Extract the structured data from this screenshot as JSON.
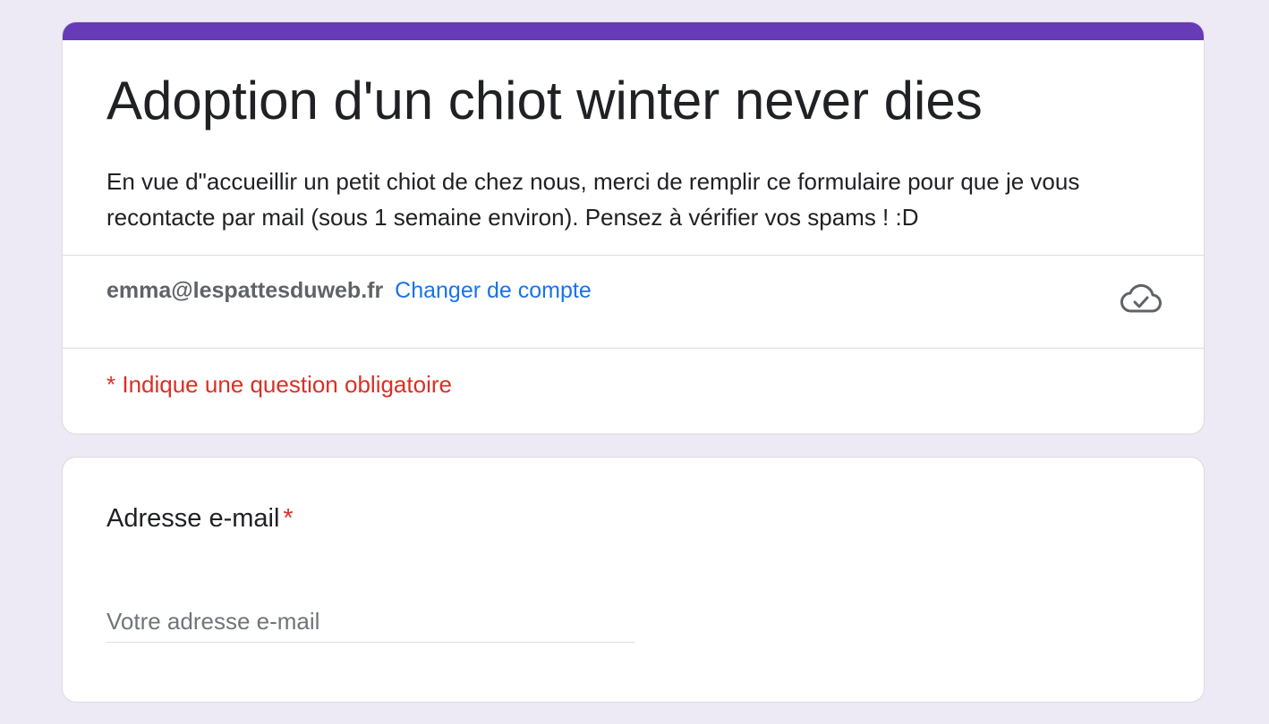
{
  "form": {
    "title": "Adoption d'un chiot winter never dies",
    "description": "En vue d\"accueillir un petit chiot de chez nous, merci de remplir ce formulaire pour que je vous recontacte par mail (sous 1 semaine environ). Pensez à vérifier vos spams ! :D",
    "accent_color": "#673ab7"
  },
  "account": {
    "email": "emma@lespattesduweb.fr",
    "switch_label": "Changer de compte",
    "status_icon": "cloud-check-icon"
  },
  "required_note": "* Indique une question obligatoire",
  "question": {
    "title": "Adresse e-mail",
    "required_marker": "*",
    "placeholder": "Votre adresse e-mail",
    "value": ""
  }
}
